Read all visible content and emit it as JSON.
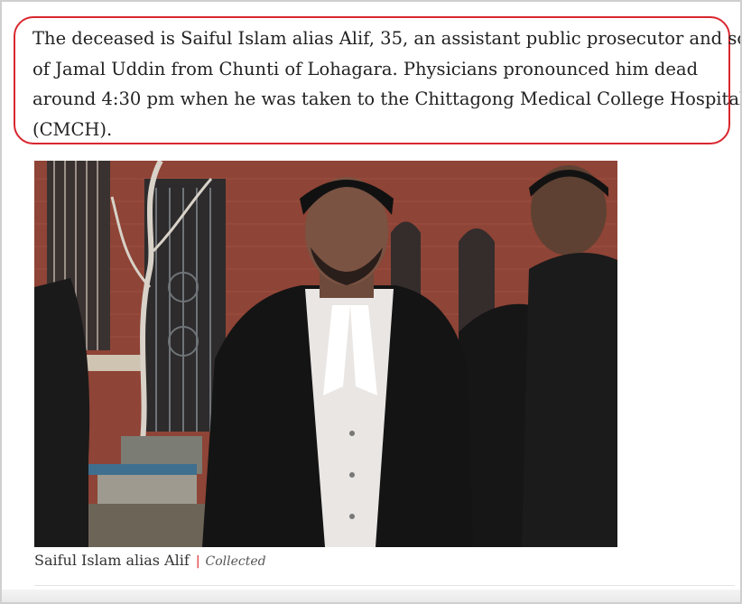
{
  "article": {
    "paragraph_lines": [
      "The deceased is Saiful Islam alias Alif, 35, an assistant public prosecutor and son",
      "of Jamal Uddin from Chunti of Lohagara. Physicians pronounced him dead",
      "around 4:30 pm when he was taken to the Chittagong Medical College Hospital",
      "(CMCH)."
    ],
    "highlight_color": "#d9262f"
  },
  "figure": {
    "caption": "Saiful Islam alias Alif",
    "separator": "|",
    "credit": "Collected"
  }
}
